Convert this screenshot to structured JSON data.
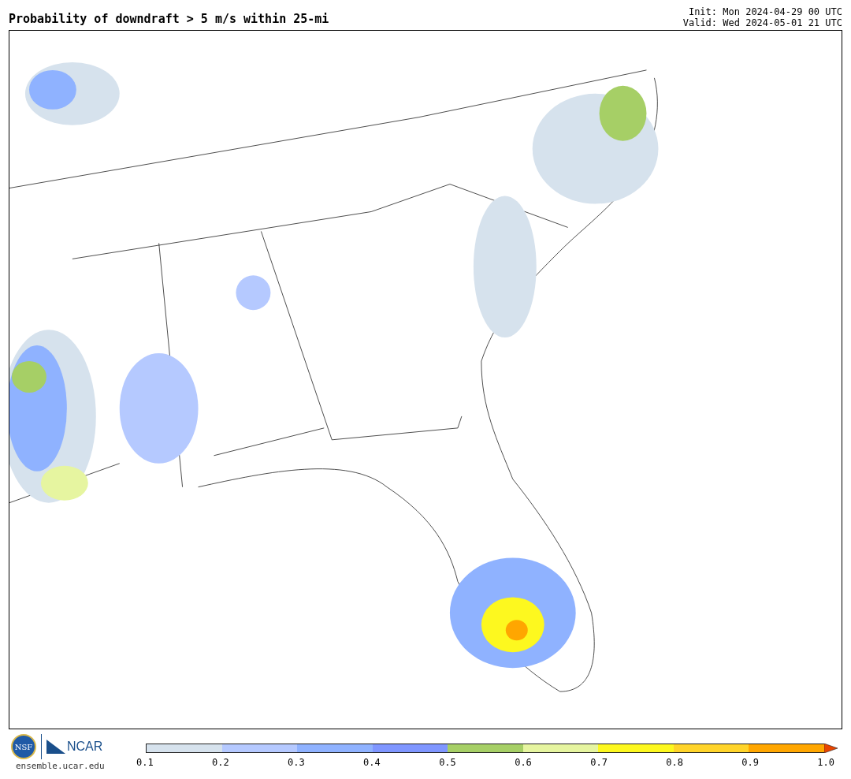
{
  "title": "Probability of downdraft > 5 m/s within 25-mi",
  "init": "Init: Mon 2024-04-29 00 UTC",
  "valid": "Valid: Wed 2024-05-01 21 UTC",
  "logos": {
    "nsf": "NSF",
    "ncar": "NCAR",
    "url": "ensemble.ucar.edu"
  },
  "colorbar": {
    "bins": [
      {
        "color": "#d6e2ed"
      },
      {
        "color": "#b5c9ff"
      },
      {
        "color": "#8fb2ff"
      },
      {
        "color": "#7f96ff"
      },
      {
        "color": "#a6cf66"
      },
      {
        "color": "#e6f5a0"
      },
      {
        "color": "#fdf81f"
      },
      {
        "color": "#ffd42a"
      },
      {
        "color": "#ffa600"
      },
      {
        "color": "#e84400",
        "kind": "extend"
      }
    ],
    "ticks": [
      "0.1",
      "0.2",
      "0.3",
      "0.4",
      "0.5",
      "0.6",
      "0.7",
      "0.8",
      "0.9",
      "1.0"
    ]
  }
}
